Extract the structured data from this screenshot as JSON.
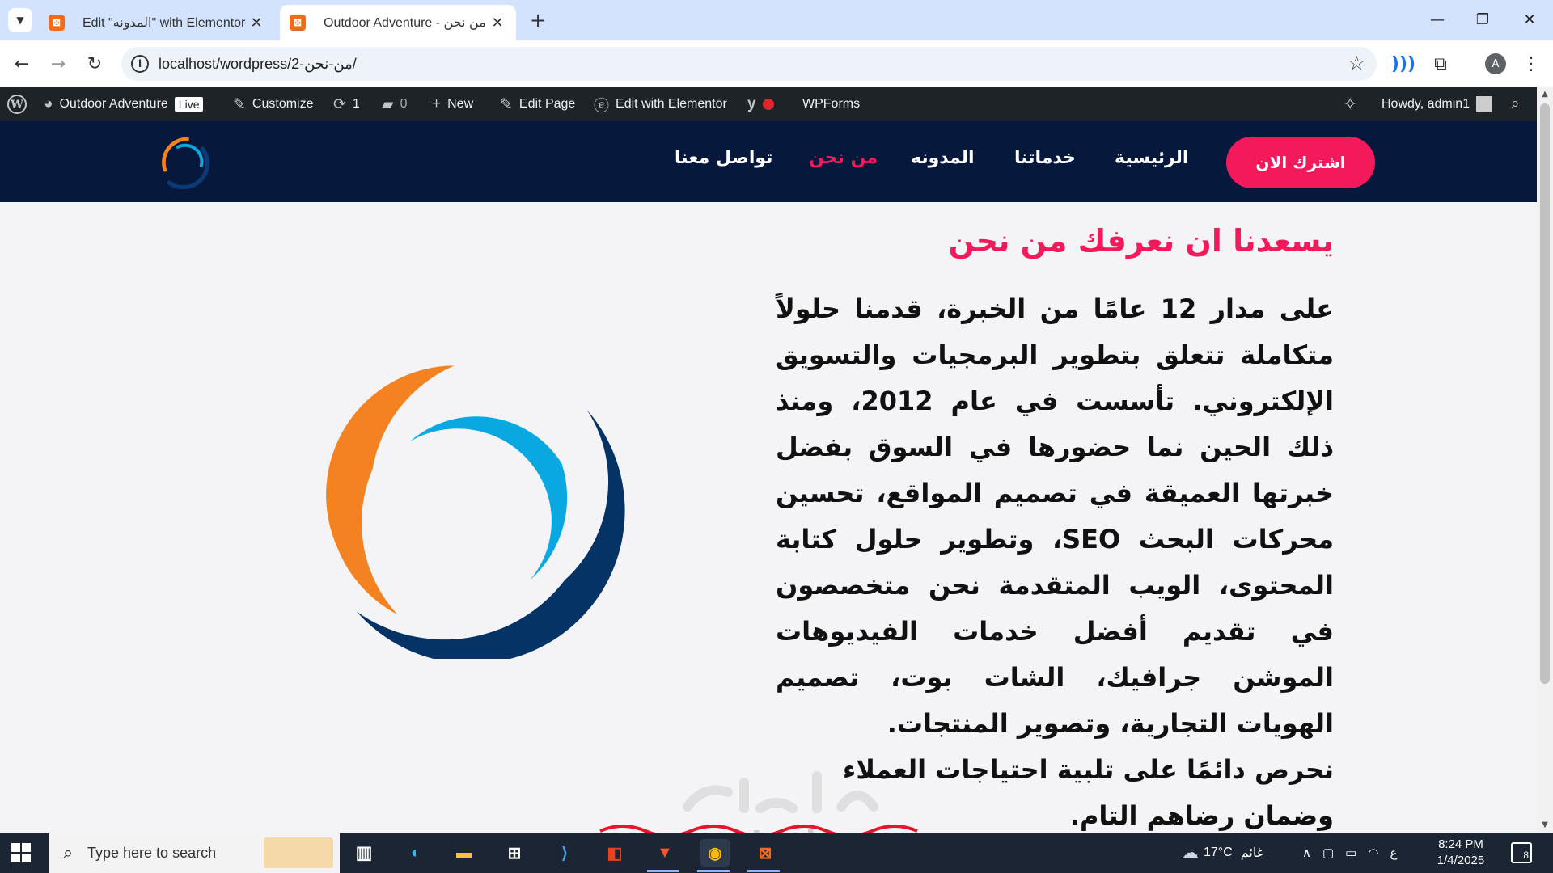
{
  "browser": {
    "tabs": [
      {
        "title": "Edit \"المدونه\" with Elementor",
        "active": false
      },
      {
        "title": "Outdoor Adventure - من نحن",
        "active": true
      }
    ],
    "url": "localhost/wordpress/2-من-نحن/",
    "profile_initial": "A"
  },
  "admin_bar": {
    "site_name": "Outdoor Adventure",
    "live_label": "Live",
    "customize": "Customize",
    "updates_count": "1",
    "comments_count": "0",
    "new": "New",
    "edit_page": "Edit Page",
    "edit_elementor": "Edit with Elementor",
    "wpforms": "WPForms",
    "howdy": "Howdy, admin1"
  },
  "site": {
    "nav": [
      {
        "label": "الرئيسية",
        "active": false
      },
      {
        "label": "خدماتنا",
        "active": false
      },
      {
        "label": "المدونه",
        "active": false
      },
      {
        "label": "من نحن",
        "active": true
      },
      {
        "label": "تواصل معنا",
        "active": false
      }
    ],
    "cta": "اشترك الان",
    "colors": {
      "header_bg": "#06193d",
      "accent": "#f21a5a",
      "logo_orange": "#f58220",
      "logo_blue": "#0aa8e0",
      "logo_navy": "#053366"
    }
  },
  "about": {
    "headline": "يسعدنا ان نعرفك من نحن",
    "paragraph": "على مدار 12 عامًا من الخبرة، قدمنا حلولاً متكاملة تتعلق بتطوير البرمجيات والتسويق الإلكتروني. تأسست في عام 2012، ومنذ ذلك الحين نما حضورها في السوق بفضل خبرتها العميقة في تصميم المواقع، تحسين محركات البحث SEO، وتطوير حلول كتابة المحتوى، الويب المتقدمة نحن متخصصون في تقديم أفضل خدمات الفيديوهات الموشن جرافيك، الشات بوت، تصميم الهويات التجارية، وتصوير المنتجات.",
    "closing": "نحرص دائمًا على تلبية احتياجات العملاء وضمان رضاهم التام."
  },
  "watermark": {
    "text": "mostaql.com"
  },
  "taskbar": {
    "search_placeholder": "Type here to search",
    "weather": "17°C",
    "weather_desc": "غائم",
    "lang": "ع",
    "time": "8:24 PM",
    "date": "1/4/2025",
    "notifications": "8"
  }
}
